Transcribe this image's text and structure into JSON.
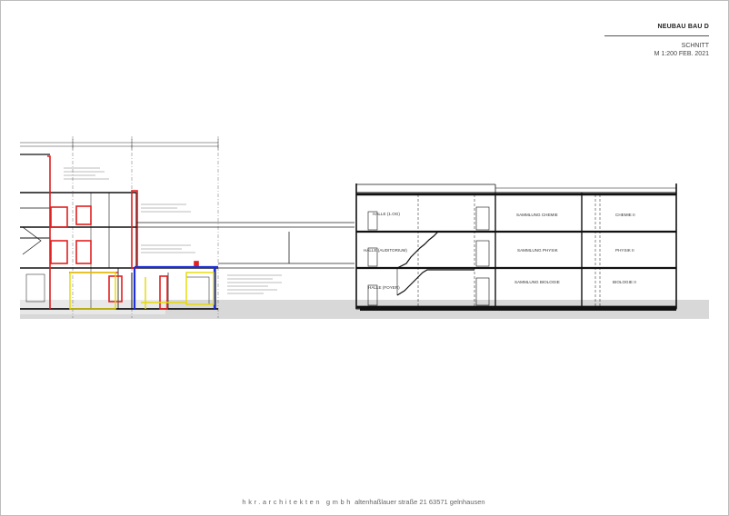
{
  "title_block": {
    "project": "NEUBAU BAU D",
    "drawing_type": "SCHNITT",
    "scale_date": "M 1:200 FEB. 2021"
  },
  "footer": {
    "firm": "hkr.architekten gmbh",
    "address": "altenhaßlauer straße 21 63571 gelnhausen"
  },
  "rooms": {
    "top_left": "HALLE (1.OG)",
    "mid_left": "HALLE (AUDITORIUM)",
    "ground_left": "HALLE (FOYER)",
    "top_center": "SAMMLUNG CHEMIE",
    "mid_center": "SAMMLUNG PHYSIK",
    "ground_center": "SAMMLUNG BIOLOGIE",
    "top_right": "CHEMIE II",
    "mid_right": "PHYSIK II",
    "ground_right": "BIOLOGIE II"
  },
  "colors": {
    "existing_red": "#e02020",
    "new_blue": "#1c2fd8",
    "yellow": "#e6d800",
    "ground": "#d8d8d8"
  }
}
